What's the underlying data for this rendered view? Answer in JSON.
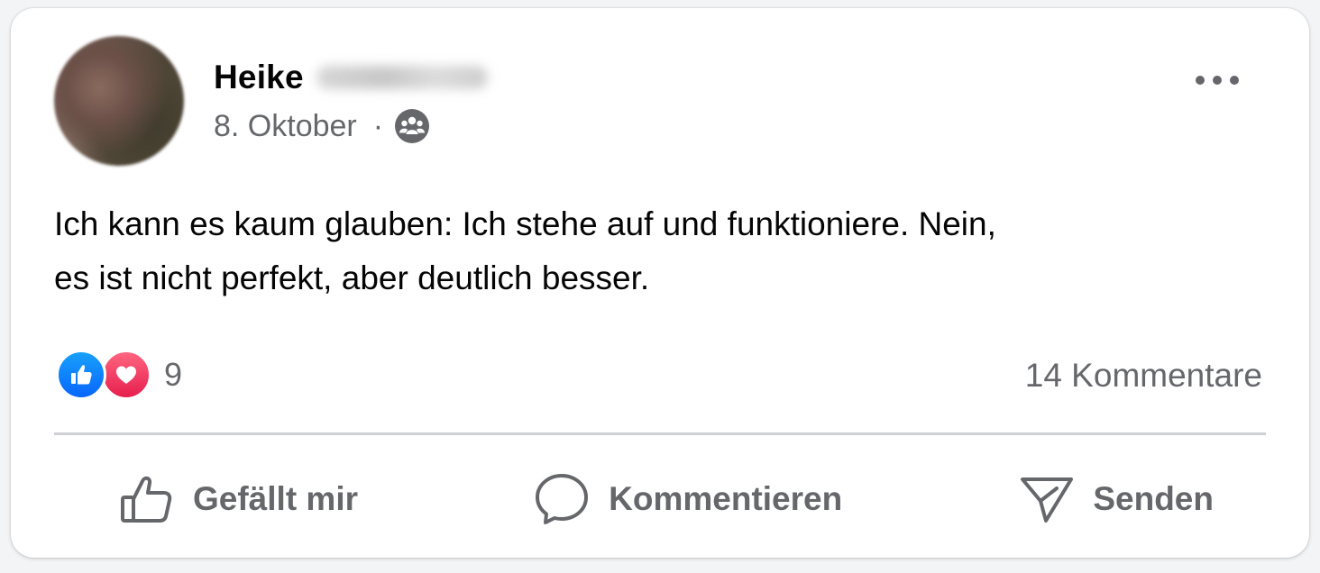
{
  "post": {
    "author_first_name": "Heike",
    "date": "8. Oktober",
    "separator": "·",
    "audience_icon": "friends-group-icon",
    "text": "Ich kann es kaum glauben: Ich stehe auf und funktioniere. Nein,\nes ist nicht perfekt, aber deutlich besser."
  },
  "reactions": {
    "icons": [
      "like-reaction-icon",
      "love-reaction-icon"
    ],
    "count": "9"
  },
  "comments": {
    "label": "14 Kommentare"
  },
  "actions": {
    "like_label": "Gefällt mir",
    "comment_label": "Kommentieren",
    "send_label": "Senden"
  },
  "colors": {
    "text_primary": "#050505",
    "text_secondary": "#65676b",
    "like_blue": "#0866ff",
    "love_red": "#e61e4d",
    "divider": "#ced0d4"
  }
}
